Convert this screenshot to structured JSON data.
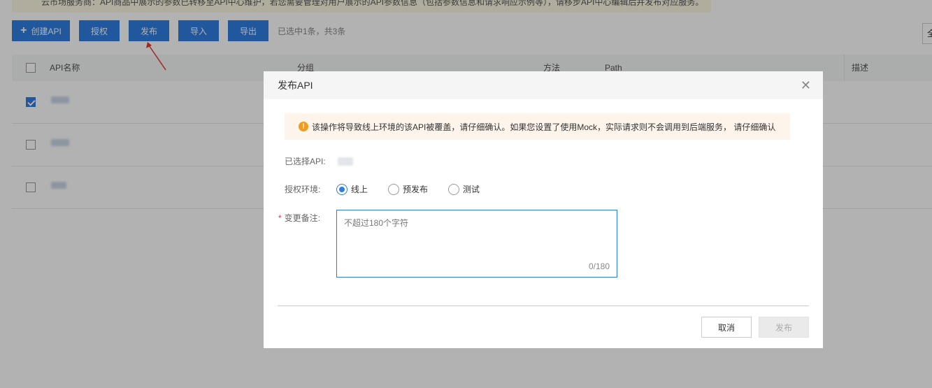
{
  "notice": "云市场服务商：API商品中展示的参数已转移至API中心维护，若您需要管理对用户展示的API参数信息（包括参数信息和请求响应示例等），请移步API中心编辑后并发布对应服务。",
  "toolbar": {
    "create_label": "创建API",
    "authorize_label": "授权",
    "publish_label": "发布",
    "import_label": "导入",
    "export_label": "导出",
    "selection_status": "已选中1条，共3条",
    "right_edge_text": "全"
  },
  "table": {
    "columns": [
      "API名称",
      "分组",
      "方法",
      "Path",
      "描述"
    ],
    "rows": [
      {
        "checked": true
      },
      {
        "checked": false
      },
      {
        "checked": false
      }
    ]
  },
  "modal": {
    "title": "发布API",
    "warning": "该操作将导致线上环境的该API被覆盖，请仔细确认。如果您设置了使用Mock，实际请求则不会调用到后端服务， 请仔细确认",
    "selected_api_label": "已选择API:",
    "env_label": "授权环境:",
    "env_options": [
      {
        "label": "线上",
        "selected": true
      },
      {
        "label": "预发布",
        "selected": false
      },
      {
        "label": "测试",
        "selected": false
      }
    ],
    "remark_label": "变更备注:",
    "remark_required_mark": "*",
    "remark_placeholder": "不超过180个字符",
    "remark_value": "",
    "remark_counter": "0/180",
    "cancel_label": "取消",
    "publish_label": "发布"
  },
  "colors": {
    "primary": "#2f7de1",
    "warning": "#f39b1c",
    "annotation_arrow": "#e8342a"
  }
}
